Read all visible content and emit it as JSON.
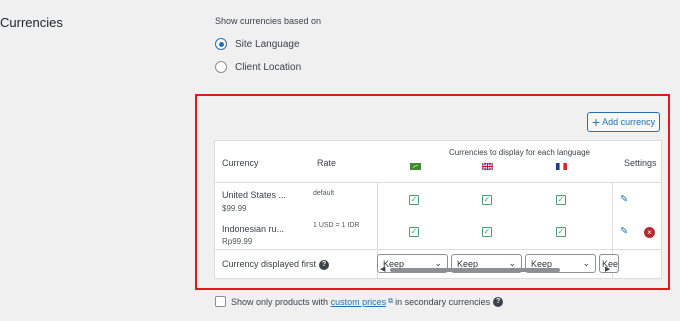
{
  "section_title": "Currencies",
  "show_label": "Show currencies based on",
  "radios": [
    {
      "label": "Site Language",
      "checked": true
    },
    {
      "label": "Client Location",
      "checked": false
    }
  ],
  "add_currency_label": "Add currency",
  "table": {
    "col_currency": "Currency",
    "col_rate": "Rate",
    "col_languages": "Currencies to display for each language",
    "col_settings": "Settings",
    "rows": [
      {
        "name": "United States ...",
        "sample": "$99.99",
        "rate": "default"
      },
      {
        "name": "Indonesian ru...",
        "sample": "Rp99.99",
        "rate": "1 USD = 1 IDR"
      }
    ],
    "displayed_first_label": "Currency displayed first",
    "select_value": "Keep"
  },
  "footer": {
    "before": "Show only products with",
    "link": "custom prices",
    "after": "in secondary currencies"
  },
  "colors": {
    "accent": "#2271b1",
    "highlight_box": "#e0191d",
    "check": "#4aa16a",
    "delete": "#b32d2e"
  }
}
